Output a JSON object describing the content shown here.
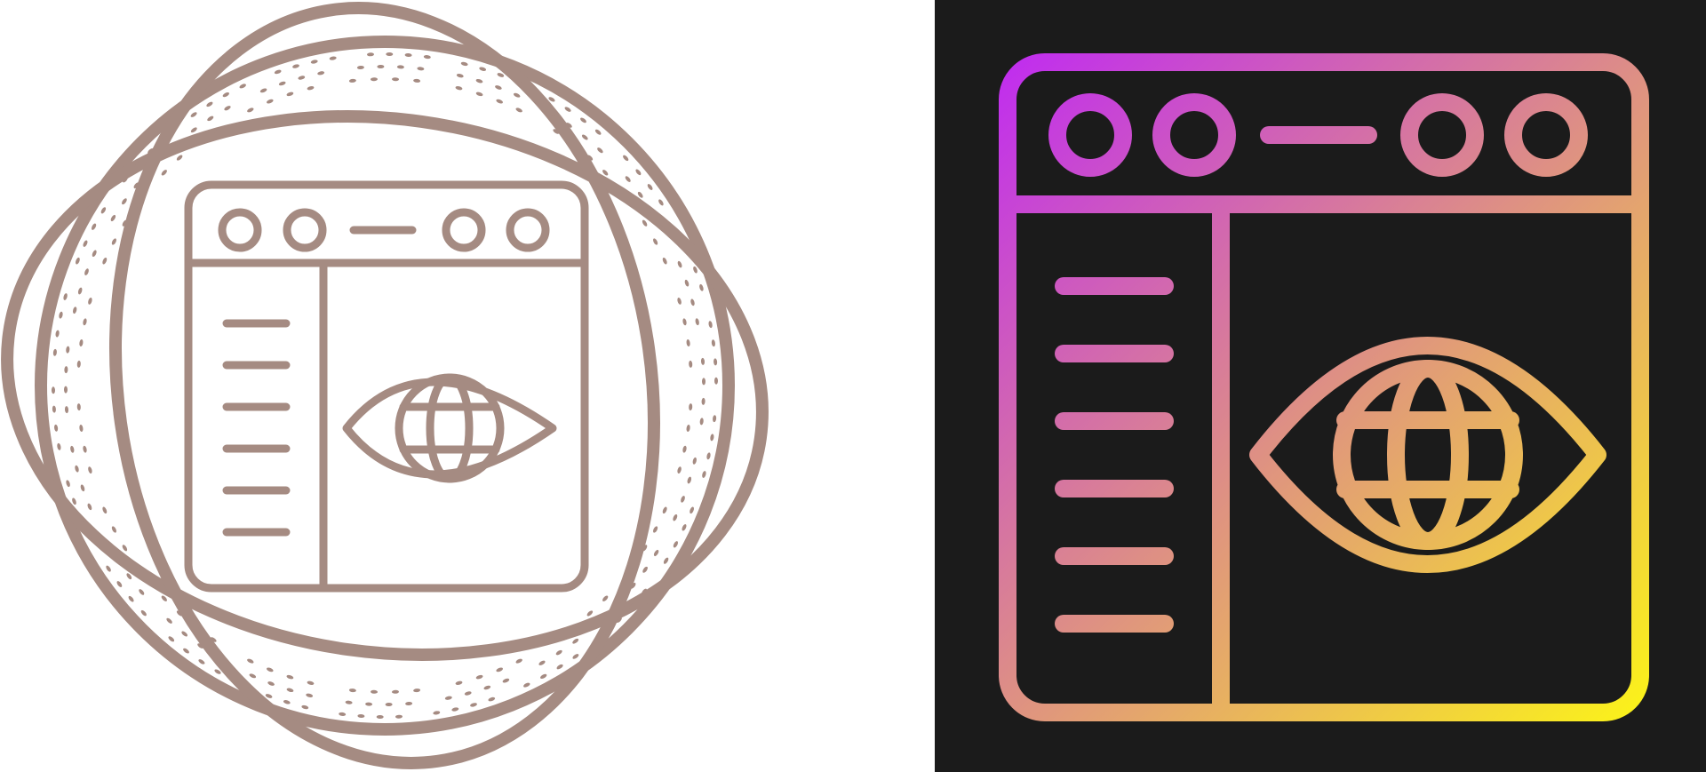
{
  "colors": {
    "left_background": "#ffffff",
    "left_stroke": "#a58b82",
    "right_background": "#1b1b1b",
    "gradient_start": "#c02cf0",
    "gradient_end": "#fbf21a"
  },
  "icons": {
    "left": "browser-eye-globe-icon",
    "right": "browser-eye-globe-icon"
  }
}
